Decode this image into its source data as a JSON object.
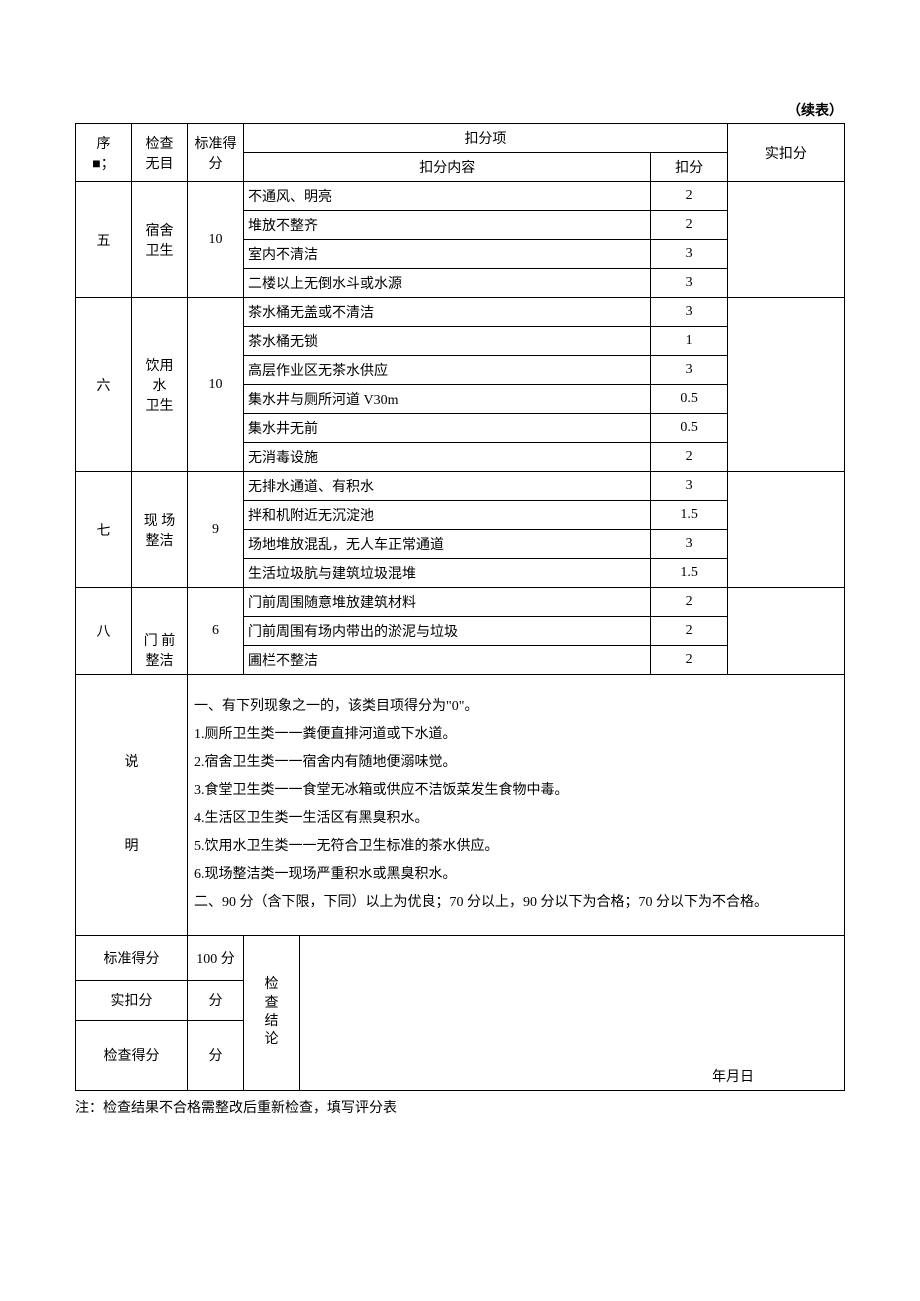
{
  "continued_label": "（续表）",
  "header": {
    "seq": "序\n■；",
    "item": "检查\n无目",
    "std_score": "标准得\n分",
    "deduction": "扣分项",
    "deduction_content": "扣分内容",
    "deduction_points": "扣分",
    "actual_deduction": "实扣分"
  },
  "sections": [
    {
      "seq": "五",
      "name": "宿舍\n卫生",
      "std": "10",
      "rows": [
        {
          "content": "不通风、明亮",
          "points": "2"
        },
        {
          "content": "堆放不整齐",
          "points": "2"
        },
        {
          "content": "室内不清洁",
          "points": "3"
        },
        {
          "content": "二楼以上无倒水斗或水源",
          "points": "3"
        }
      ]
    },
    {
      "seq": "六",
      "name": "饮用\n水\n卫生",
      "std": "10",
      "rows": [
        {
          "content": "茶水桶无盖或不清洁",
          "points": "3"
        },
        {
          "content": "茶水桶无锁",
          "points": "1"
        },
        {
          "content": "高层作业区无茶水供应",
          "points": "3"
        },
        {
          "content": "集水井与厕所河道 V30m",
          "points": "0.5"
        },
        {
          "content": "集水井无前",
          "points": "0.5"
        },
        {
          "content": "无消毒设施",
          "points": "2"
        }
      ]
    },
    {
      "seq": "七",
      "name": "现 场\n整洁",
      "std": "9",
      "rows": [
        {
          "content": "无排水通道、有积水",
          "points": "3"
        },
        {
          "content": "拌和机附近无沉淀池",
          "points": "1.5"
        },
        {
          "content": "场地堆放混乱，无人车正常通道",
          "points": "3"
        },
        {
          "content": "生活垃圾肮与建筑垃圾混堆",
          "points": "1.5"
        }
      ]
    },
    {
      "seq": "八",
      "name": "门 前\n整洁",
      "std": "6",
      "rows": [
        {
          "content": "门前周围随意堆放建筑材料",
          "points": "2"
        },
        {
          "content": "门前周围有场内带出的淤泥与垃圾",
          "points": "2"
        },
        {
          "content": "圃栏不整洁",
          "points": "2"
        }
      ]
    }
  ],
  "notes": {
    "label": "说\n\n明",
    "lines": [
      "一、有下列现象之一的，该类目项得分为\"0\"。",
      "1.厕所卫生类一一粪便直排河道或下水道。",
      "2.宿舍卫生类一一宿舍内有随地便溺味觉。",
      "3.食堂卫生类一一食堂无冰箱或供应不洁饭菜发生食物中毒。",
      "4.生活区卫生类一生活区有黑臭积水。",
      "5.饮用水卫生类一一无符合卫生标准的茶水供应。",
      "6.现场整洁类一现场严重积水或黑臭积水。",
      "二、90 分（含下限，下同）以上为优良；70 分以上，90 分以下为合格；70 分以下为不合格。"
    ]
  },
  "summary": {
    "std_score_label": "标准得分",
    "std_score_value": "100 分",
    "actual_label": "实扣分",
    "actual_value": "分",
    "check_score_label": "检查得分",
    "check_score_value": "分",
    "conclusion_label": "检\n查\n结\n论",
    "date": "年月日"
  },
  "footnote": "注：检查结果不合格需整改后重新检查，填写评分表"
}
